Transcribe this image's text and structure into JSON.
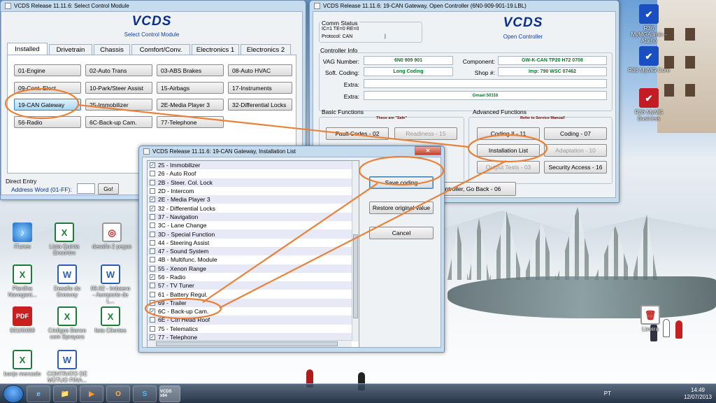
{
  "desktop": {
    "icons": [
      {
        "label": "iTunes",
        "glyph": "♪",
        "kind": "itunes"
      },
      {
        "label": "Lista Quinta Encontro",
        "glyph": "X",
        "kind": "excel"
      },
      {
        "label": "desafio 2 pegas",
        "glyph": "◎",
        "kind": "app"
      },
      {
        "label": "Planilha Navegant...",
        "glyph": "X",
        "kind": "excel"
      },
      {
        "label": "Desafio do Groovey",
        "glyph": "W",
        "kind": "word"
      },
      {
        "label": "09.02 - Imbaero - Aeroporto de L...",
        "glyph": "W",
        "kind": "word"
      },
      {
        "label": "93105689",
        "glyph": "PDF",
        "kind": "pdf"
      },
      {
        "label": "Códigos Banco com Sprayers",
        "glyph": "X",
        "kind": "excel"
      },
      {
        "label": "lista Clientes",
        "glyph": "X",
        "kind": "excel"
      },
      {
        "label": "banjo mercado",
        "glyph": "X",
        "kind": "excel"
      },
      {
        "label": "CONTRATO DE MÚTUO FINA...",
        "glyph": "W",
        "kind": "word"
      },
      {
        "label": "R36 MyMGAdmin - Atalho",
        "glyph": "✔",
        "kind": "check"
      },
      {
        "label": "R36 MyMG Core",
        "glyph": "✔",
        "kind": "check"
      },
      {
        "label": "R36 MyMG Business",
        "glyph": "✔",
        "kind": "check2"
      },
      {
        "label": "Lixeira",
        "glyph": "🗑",
        "kind": "app"
      }
    ]
  },
  "win1": {
    "title": "VCDS Release 11.11.6:  Select Control Module",
    "logo": "VCDS",
    "subtitle": "Select Control Module",
    "tabs": [
      "Installed",
      "Drivetrain",
      "Chassis",
      "Comfort/Conv.",
      "Electronics 1",
      "Electronics 2"
    ],
    "modules": [
      "01-Engine",
      "02-Auto Trans",
      "03-ABS Brakes",
      "08-Auto HVAC",
      "09-Cent. Elect.",
      "10-Park/Steer Assist",
      "15-Airbags",
      "17-Instruments",
      "19-CAN Gateway",
      "25-Immobilizer",
      "2E-Media Player 3",
      "32-Differential Locks",
      "56-Radio",
      "6C-Back-up Cam.",
      "77-Telephone"
    ],
    "direct_entry": "Direct Entry",
    "address_label": "Address Word (01-FF):",
    "go": "Go!"
  },
  "win2": {
    "title": "VCDS Release 11.11.6: 19-CAN Gateway,  Open Controller (6N0-909-901-19.LBL)",
    "comm_status": "Comm Status",
    "comm_values": "IC=1  TE=0  RE=0",
    "protocol": "Protocol: CAN",
    "protocol_mark": "|",
    "logo": "VCDS",
    "subtitle": "Open Controller",
    "controller_info": "Controller Info",
    "vag_label": "VAG Number:",
    "vag_value": "6N0 909 901",
    "component_label": "Component:",
    "component_value": "GW-K-CAN TP20 H72 0708",
    "coding_label": "Soft. Coding:",
    "coding_value": "Long Coding",
    "shop_label": "Shop #:",
    "shop_value": "Imp: 790     WSC 07462",
    "extra_label": "Extra:",
    "extra2_value": "Gmael 50316",
    "basic": "Basic Functions",
    "basic_note": "These are \"Safe\"",
    "advanced": "Advanced Functions",
    "advanced_note": "Refer to Service Manual!",
    "fault_codes": "Fault Codes - 02",
    "readiness": "Readiness - 15",
    "coding_ii": "Coding II - 11",
    "coding_07": "Coding - 07",
    "install_list": "Installation List",
    "adaptation": "Adaptation - 10",
    "output_tests": "Output Tests - 03",
    "security": "Security Access - 16",
    "close_go_back": "Close Controller, Go Back - 06"
  },
  "win3": {
    "title": "VCDS Release 11.11.6: 19-CAN Gateway,  Installation List",
    "save": "Save coding",
    "restore": "Restore original value",
    "cancel": "Cancel",
    "items": [
      {
        "label": "25 - Immobilizer",
        "checked": true
      },
      {
        "label": "26 - Auto Roof",
        "checked": false
      },
      {
        "label": "2B - Steer. Col. Lock",
        "checked": false
      },
      {
        "label": "2D - Intercom",
        "checked": false
      },
      {
        "label": "2E - Media Player 3",
        "checked": true
      },
      {
        "label": "32 - Differential Locks",
        "checked": true
      },
      {
        "label": "37 - Navigation",
        "checked": false
      },
      {
        "label": "3C - Lane Change",
        "checked": false
      },
      {
        "label": "3D - Special Function",
        "checked": false
      },
      {
        "label": "44 - Steering Assist",
        "checked": false
      },
      {
        "label": "47 - Sound System",
        "checked": false
      },
      {
        "label": "4B - Multifunc. Module",
        "checked": false
      },
      {
        "label": "55 - Xenon Range",
        "checked": false
      },
      {
        "label": "56 - Radio",
        "checked": true
      },
      {
        "label": "57 - TV Tuner",
        "checked": false
      },
      {
        "label": "61 - Battery Regul.",
        "checked": false
      },
      {
        "label": "69 - Trailer",
        "checked": false
      },
      {
        "label": "6C - Back-up Cam.",
        "checked": true
      },
      {
        "label": "6E - Ctrl Head Roof",
        "checked": false
      },
      {
        "label": "75 - Telematics",
        "checked": false
      },
      {
        "label": "77 - Telephone",
        "checked": true
      }
    ]
  },
  "taskbar": {
    "items": [
      "e",
      "📁",
      "▶",
      "O",
      "S",
      "VCDS x64"
    ],
    "lang": "PT",
    "time": "14:49",
    "date": "12/07/2013"
  },
  "colors": {
    "annotation": "#e8823a",
    "accent": "#0b2f8f",
    "value_green": "#007a2a"
  }
}
